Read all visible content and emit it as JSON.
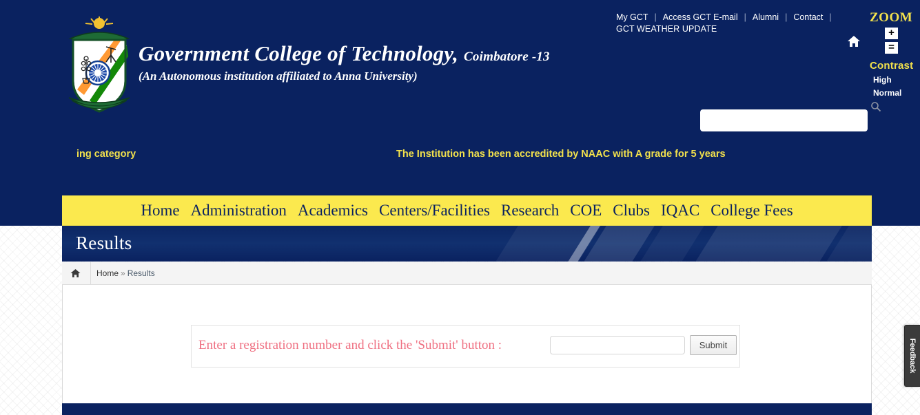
{
  "header": {
    "college_name": "Government College of Technology,",
    "city": "Coimbatore -13",
    "subtitle": "(An Autonomous institution affiliated to Anna University)",
    "logo_icon": "college-crest-logo",
    "home_icon": "home-icon",
    "utility_links": [
      {
        "label": "My GCT"
      },
      {
        "label": "Access GCT E-mail"
      },
      {
        "label": "Alumni"
      },
      {
        "label": "Contact"
      }
    ],
    "weather_label": "GCT WEATHER UPDATE",
    "separator": "|"
  },
  "accessibility": {
    "zoom_title": "ZOOM",
    "zoom_in_label": "+",
    "zoom_reset_label": "=",
    "contrast_title": "Contrast",
    "contrast_options": [
      {
        "label": "High"
      },
      {
        "label": "Normal"
      }
    ]
  },
  "search": {
    "value": "",
    "placeholder": "",
    "icon": "search-icon"
  },
  "marquee": {
    "left_text": "ing category",
    "center_text": "The Institution has been accredited by NAAC with A grade for 5 years"
  },
  "nav": {
    "items": [
      {
        "label": "Home"
      },
      {
        "label": "Administration"
      },
      {
        "label": "Academics"
      },
      {
        "label": "Centers/Facilities"
      },
      {
        "label": "Research"
      },
      {
        "label": "COE"
      },
      {
        "label": "Clubs"
      },
      {
        "label": "IQAC"
      },
      {
        "label": "College Fees"
      }
    ]
  },
  "page": {
    "title": "Results"
  },
  "breadcrumb": {
    "home_icon": "home-icon",
    "home_label": "Home",
    "separator": "»",
    "current_label": "Results"
  },
  "form": {
    "label": "Enter a registration number and click the 'Submit' button :",
    "input_value": "",
    "input_placeholder": "",
    "submit_label": "Submit"
  },
  "feedback": {
    "label": "Feedback"
  },
  "colors": {
    "navy": "#0a2260",
    "yellow_nav": "#fbe94e",
    "marquee_yellow": "#f2e14c",
    "accent_pink": "#ef6f81",
    "banner_blue": "#11306f"
  }
}
